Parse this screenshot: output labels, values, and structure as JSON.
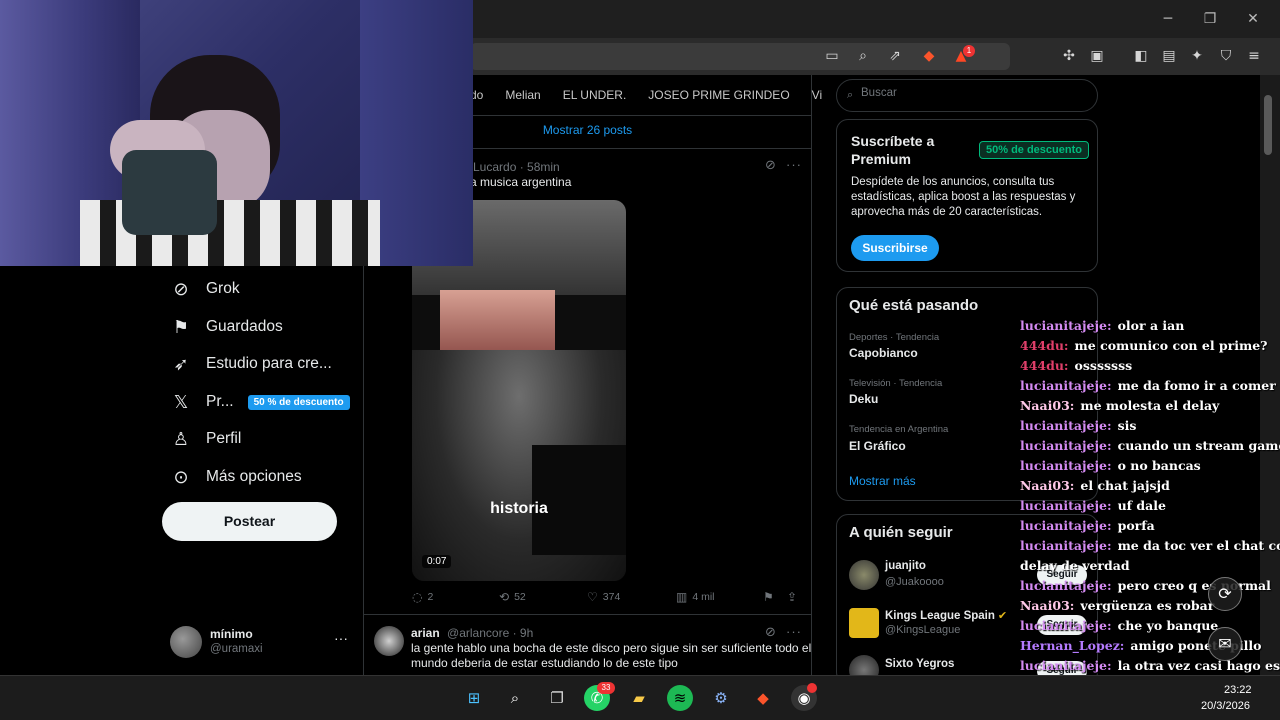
{
  "window": {
    "minimize_glyph": "─",
    "maximize_glyph": "❐",
    "close_glyph": "✕"
  },
  "toolbar": {
    "icons": [
      "cast-icon",
      "zoom-icon",
      "share-icon",
      "brave-shields-icon",
      "brave-rewards-icon",
      "extensions-icon",
      "reading-list-icon",
      "sidebar-icon",
      "wallet-icon",
      "leo-ai-icon",
      "vpn-icon",
      "menu-icon"
    ],
    "rewards_badge": "1"
  },
  "nav": {
    "items": [
      {
        "label": "Grok",
        "icon": "grok-icon"
      },
      {
        "label": "Guardados",
        "icon": "bookmark-icon"
      },
      {
        "label": "Estudio para cre...",
        "icon": "rocket-icon"
      },
      {
        "label": "Pr...",
        "icon": "x-logo-icon",
        "badge": "50 % de descuento"
      },
      {
        "label": "Perfil",
        "icon": "person-icon"
      },
      {
        "label": "Más opciones",
        "icon": "more-circle-icon"
      }
    ],
    "post_button": "Postear",
    "profile": {
      "name": "mínimo",
      "handle": "@uramaxi",
      "more": "···"
    }
  },
  "timeline": {
    "tabs": [
      "do",
      "Melian",
      "EL UNDER.",
      "JOSEO PRIME GRINDEO",
      "Vi"
    ],
    "show_posts": "Mostrar 26 posts",
    "tweet1": {
      "meta": "Lucardo · 58min",
      "text": "a musica argentina",
      "video_caption": "historia",
      "video_time": "0:07",
      "replies": "2",
      "reposts": "52",
      "likes": "374",
      "views": "4 mil"
    },
    "tweet2": {
      "name": "arian",
      "meta": "@arlancore · 9h",
      "text_line1": "la gente hablo una bocha de este disco pero sigue sin ser suficiente todo el",
      "text_line2": "mundo deberia de estar estudiando lo de este tipo"
    }
  },
  "sidebar": {
    "search_placeholder": "Buscar",
    "premium": {
      "title": "Suscríbete a Premium",
      "badge": "50% de descuento",
      "description": "Despídete de los anuncios, consulta tus estadísticas, aplica boost a las respuestas y aprovecha más de 20 características.",
      "button": "Suscribirse"
    },
    "trends": {
      "title": "Qué está pasando",
      "items": [
        {
          "category": "Deportes · Tendencia",
          "name": "Capobianco"
        },
        {
          "category": "Televisión · Tendencia",
          "name": "Deku"
        },
        {
          "category": "Tendencia en Argentina",
          "name": "El Gráfico"
        }
      ],
      "show_more": "Mostrar más"
    },
    "follow": {
      "title": "A quién seguir",
      "items": [
        {
          "name": "juanjito",
          "handle": "@Juakoooo",
          "button": "Seguir"
        },
        {
          "name": "Kings League Spain",
          "handle": "@KingsLeague",
          "button": "Seguir",
          "verified": "✔"
        },
        {
          "name": "Sixto Yegros",
          "handle": "",
          "button": "Seguir"
        }
      ]
    }
  },
  "chat": {
    "messages": [
      {
        "user": "lucianitajeje:",
        "msg": "olor a ian",
        "color": "#d48bf2"
      },
      {
        "user": "444du:",
        "msg": "me comunico con el prime?",
        "color": "#e03f6a"
      },
      {
        "user": "444du:",
        "msg": "osssssss",
        "color": "#e03f6a"
      },
      {
        "user": "lucianitajeje:",
        "msg": "me da fomo ir a comer",
        "color": "#d48bf2"
      },
      {
        "user": "Naai03:",
        "msg": "me molesta el delay",
        "color": "#ffc8e8"
      },
      {
        "user": "lucianitajeje:",
        "msg": "sis",
        "color": "#d48bf2"
      },
      {
        "user": "lucianitajeje:",
        "msg": "cuando un stream gamer",
        "color": "#d48bf2"
      },
      {
        "user": "lucianitajeje:",
        "msg": "o no bancas",
        "color": "#d48bf2"
      },
      {
        "user": "Naai03:",
        "msg": "el chat jajsjd",
        "color": "#ffc8e8"
      },
      {
        "user": "lucianitajeje:",
        "msg": "uf dale",
        "color": "#d48bf2"
      },
      {
        "user": "lucianitajeje:",
        "msg": "porfa",
        "color": "#d48bf2"
      },
      {
        "user": "lucianitajeje:",
        "msg": "me da toc ver el chat con",
        "color": "#d48bf2"
      },
      {
        "user": "",
        "msg": "delay de verdad",
        "color": "#d48bf2"
      },
      {
        "user": "lucianitajeje:",
        "msg": "pero creo q es normal",
        "color": "#d48bf2"
      },
      {
        "user": "Naai03:",
        "msg": "vergüenza es robar",
        "color": "#ffc8e8"
      },
      {
        "user": "lucianitajeje:",
        "msg": "che yo banque",
        "color": "#d48bf2"
      },
      {
        "user": "Hernan_Lopez:",
        "msg": "amigo ponete pillo",
        "color": "#b57bff"
      },
      {
        "user": "lucianitajeje:",
        "msg": "la otra vez casi hago eso",
        "color": "#d48bf2"
      },
      {
        "user": "",
        "msg": "kajs",
        "color": "#d48bf2"
      },
      {
        "user": "Naai03:",
        "msg": "jajsjsjwjd",
        "color": "#ffc8e8"
      }
    ]
  },
  "taskbar": {
    "whatsapp_badge": "33",
    "time": "23:22",
    "date": "20/3/2026"
  }
}
